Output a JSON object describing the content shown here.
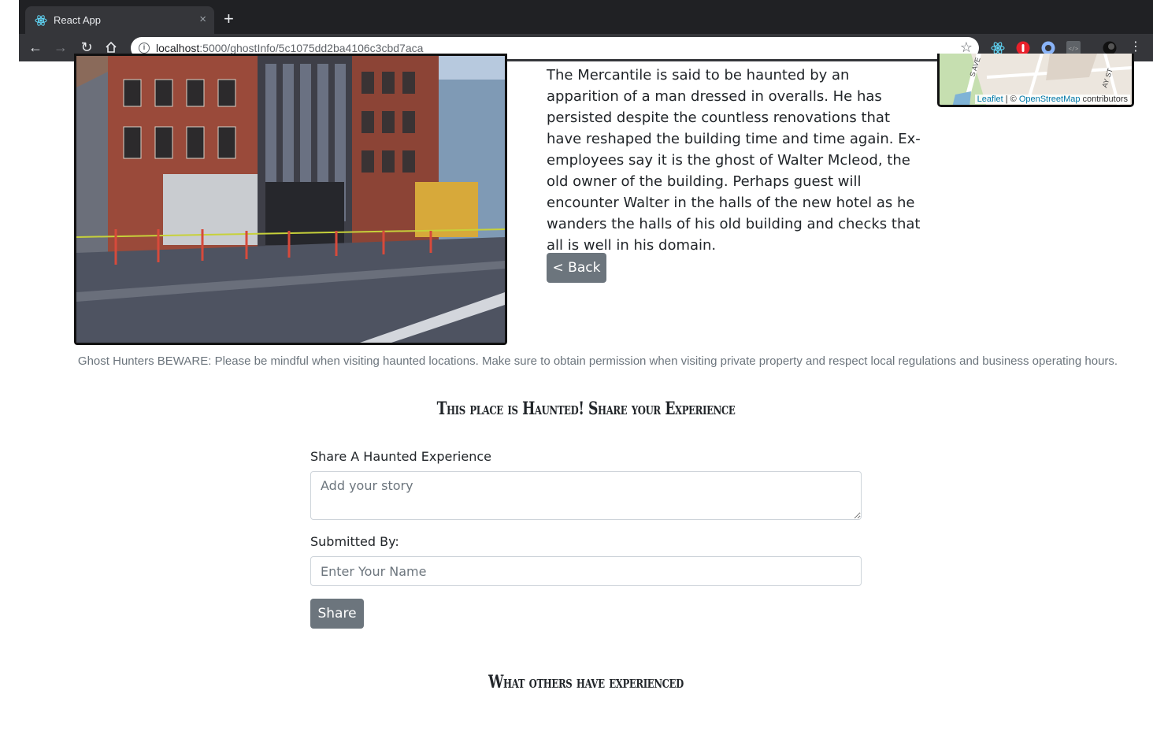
{
  "browser": {
    "tab_title": "React App",
    "tab_close": "×",
    "new_tab": "+",
    "url_host": "localhost",
    "url_path": ":5000/ghostInfo/5c1075dd2ba4106c3cbd7aca"
  },
  "ghost": {
    "description": "The Mercantile is said to be haunted by an apparition of a man dressed in overalls. He has persisted despite the countless renovations that have reshaped the building time and time again. Ex-employees say it is the ghost of Walter Mcleod, the old owner of the building. Perhaps guest will encounter Walter in the halls of the new hotel as he wanders the halls of his old building and checks that all is well in his domain.",
    "back_label": "< Back"
  },
  "map": {
    "street_1": "S AVE",
    "street_2": "AY ST",
    "attrib_leaflet": "Leaflet",
    "attrib_sep": " | © ",
    "attrib_osm": "OpenStreetMap",
    "attrib_contrib": " contributors"
  },
  "warning": "Ghost Hunters BEWARE: Please be mindful when visiting haunted locations. Make sure to obtain permission when visiting private property and respect local regulations and business operating hours.",
  "share_section": {
    "heading": "This place is Haunted! Share your Experience",
    "story_label": "Share A Haunted Experience",
    "story_placeholder": "Add your story",
    "name_label": "Submitted By:",
    "name_placeholder": "Enter Your Name",
    "share_label": "Share"
  },
  "others_section": {
    "heading": "What others have experienced"
  }
}
